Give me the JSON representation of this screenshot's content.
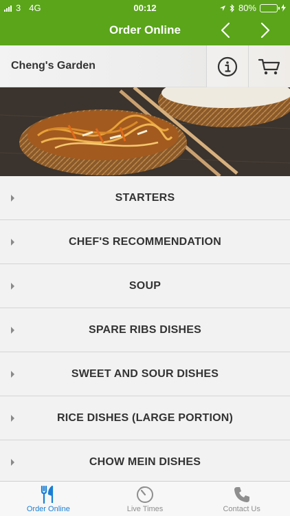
{
  "status_bar": {
    "carrier": "3",
    "network": "4G",
    "time": "00:12",
    "battery_percent": "80%",
    "battery_level": 0.8
  },
  "nav": {
    "title": "Order Online",
    "prev_icon": "chevron-left-icon",
    "next_icon": "chevron-right-icon"
  },
  "restaurant": {
    "name": "Cheng's Garden",
    "info_icon": "info-icon",
    "cart_icon": "cart-icon"
  },
  "hero": {
    "image": "chow mein noodles in woven bowls with chopsticks"
  },
  "categories": [
    {
      "label": "STARTERS"
    },
    {
      "label": "CHEF'S RECOMMENDATION"
    },
    {
      "label": "SOUP"
    },
    {
      "label": "SPARE RIBS DISHES"
    },
    {
      "label": "SWEET AND SOUR DISHES"
    },
    {
      "label": "RICE DISHES (LARGE PORTION)"
    },
    {
      "label": "CHOW MEIN DISHES"
    }
  ],
  "tabs": [
    {
      "label": "Order Online",
      "icon": "fork-knife-icon",
      "active": true
    },
    {
      "label": "Live Times",
      "icon": "timer-icon",
      "active": false
    },
    {
      "label": "Contact Us",
      "icon": "phone-icon",
      "active": false
    }
  ],
  "colors": {
    "brand_green": "#5aa51a",
    "active_tab": "#1a7fd4",
    "inactive_tab": "#8e8e8e"
  }
}
